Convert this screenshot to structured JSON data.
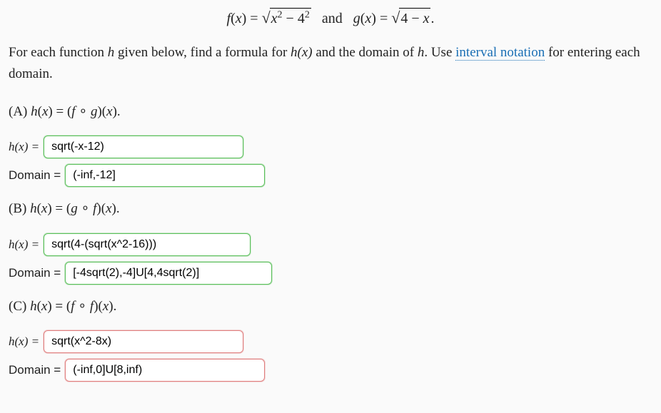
{
  "header": {
    "formula_html": "<span class='ital'>f</span>(<span class='ital'>x</span>) = <span class='sqrt'><span class='radicand'><span class='ital'>x</span><sup>2</sup> − 4<sup>2</sup></span></span>&nbsp;&nbsp;&nbsp;and&nbsp;&nbsp;&nbsp;<span class='ital'>g</span>(<span class='ital'>x</span>) = <span class='sqrt'><span class='radicand'>4 − <span class='ital'>x</span></span></span>."
  },
  "instructions": {
    "pre": "For each function ",
    "h": "h",
    "mid1": " given below, find a formula for ",
    "hx": "h(x)",
    "mid2": " and the domain of ",
    "h2": "h",
    "mid3": ". Use ",
    "link": "interval notation",
    "post": " for entering each domain."
  },
  "parts": {
    "A": {
      "label_html": "(A) <span class='ital'>h</span>(<span class='ital'>x</span>) = (<span class='ital'>f</span> ∘ <span class='ital'>g</span>)(<span class='ital'>x</span>).",
      "hx_label": "h(x) = ",
      "hx_value": "sqrt(-x-12)",
      "hx_status": "correct",
      "domain_label": "Domain = ",
      "domain_value": "(-inf,-12]",
      "domain_status": "correct"
    },
    "B": {
      "label_html": "(B) <span class='ital'>h</span>(<span class='ital'>x</span>) = (<span class='ital'>g</span> ∘ <span class='ital'>f</span>)(<span class='ital'>x</span>).",
      "hx_label": "h(x) = ",
      "hx_value": "sqrt(4-(sqrt(x^2-16)))",
      "hx_status": "correct",
      "domain_label": "Domain = ",
      "domain_value": "[-4sqrt(2),-4]U[4,4sqrt(2)]",
      "domain_status": "correct"
    },
    "C": {
      "label_html": "(C) <span class='ital'>h</span>(<span class='ital'>x</span>) = (<span class='ital'>f</span> ∘ <span class='ital'>f</span>)(<span class='ital'>x</span>).",
      "hx_label": "h(x) = ",
      "hx_value": "sqrt(x^2-8x)",
      "hx_status": "incorrect",
      "domain_label": "Domain = ",
      "domain_value": "(-inf,0]U[8,inf)",
      "domain_status": "incorrect"
    }
  }
}
